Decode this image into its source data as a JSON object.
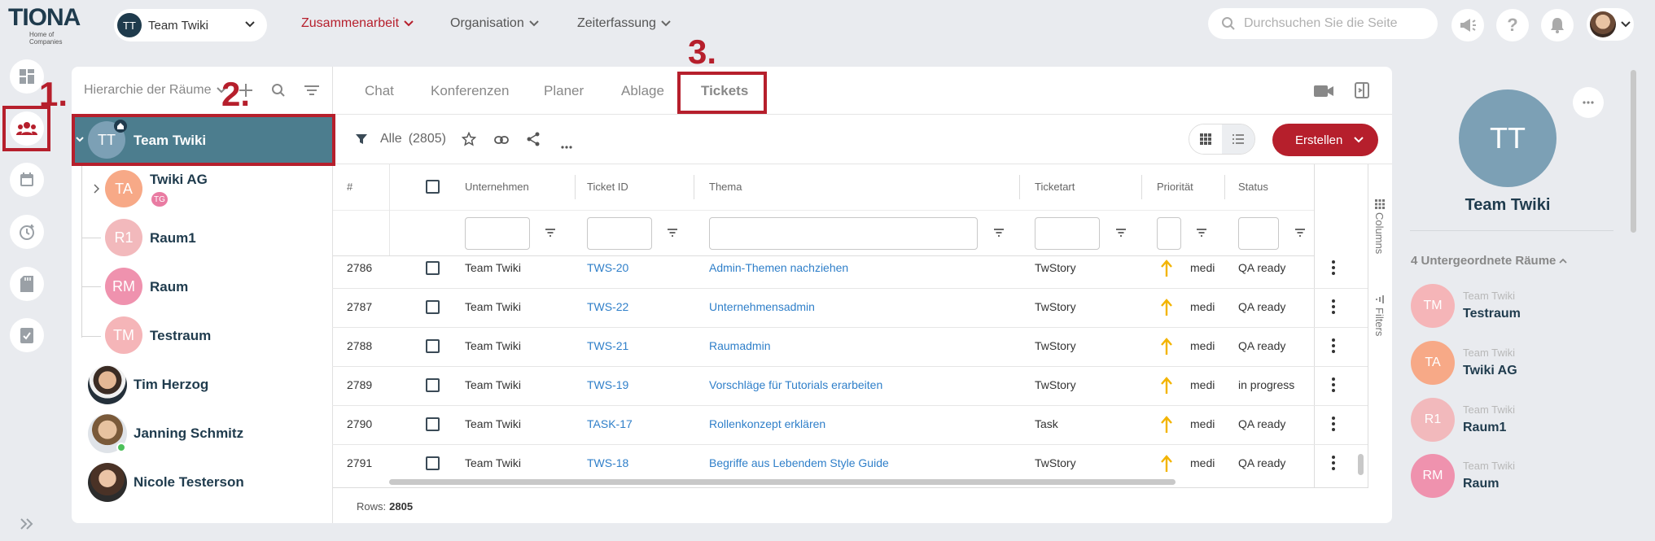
{
  "header": {
    "logo_text": "TIONA",
    "logo_sub": "Home of Companies",
    "team_selector": {
      "initials": "TT",
      "label": "Team Twiki"
    },
    "nav": [
      {
        "label": "Zusammenarbeit",
        "active": true
      },
      {
        "label": "Organisation",
        "active": false
      },
      {
        "label": "Zeiterfassung",
        "active": false
      }
    ],
    "search_placeholder": "Durchsuchen Sie die Seite",
    "icons": [
      "megaphone-icon",
      "help-icon",
      "bell-icon",
      "user-avatar"
    ]
  },
  "annotations": [
    "1.",
    "2.",
    "3."
  ],
  "left_nav": {
    "icons": [
      "dashboard-icon",
      "team-icon",
      "calendar-icon",
      "time-icon",
      "document-icon",
      "checklist-icon"
    ],
    "expand_icon": "double-chevron-right-icon"
  },
  "hierarchy": {
    "title": "Hierarchie der Räume",
    "items": [
      {
        "initials": "TT",
        "label": "Team Twiki",
        "color": "#7ca0b5",
        "selected": true
      },
      {
        "initials": "TA",
        "label": "Twiki AG",
        "badge": "TG",
        "color": "#f7a987"
      },
      {
        "initials": "R1",
        "label": "Raum1",
        "color": "#f2b9bc"
      },
      {
        "initials": "RM",
        "label": "Raum",
        "color": "#ef92ae"
      },
      {
        "initials": "TM",
        "label": "Testraum",
        "color": "#f5b5b8"
      }
    ],
    "users": [
      {
        "label": "Tim Herzog"
      },
      {
        "label": "Janning Schmitz"
      },
      {
        "label": "Nicole Testerson"
      }
    ]
  },
  "tabs": [
    {
      "label": "Chat"
    },
    {
      "label": "Konferenzen"
    },
    {
      "label": "Planer"
    },
    {
      "label": "Ablage"
    },
    {
      "label": "Tickets",
      "active": true
    }
  ],
  "toolbar": {
    "filter_label": "Alle",
    "count": "(2805)",
    "create_label": "Erstellen"
  },
  "table": {
    "columns": [
      "#",
      "Unternehmen",
      "Ticket ID",
      "Thema",
      "Ticketart",
      "Priorität",
      "Status"
    ],
    "rows": [
      {
        "num": "2786",
        "company": "Team Twiki",
        "id": "TWS-20",
        "topic": "Admin-Themen nachziehen",
        "type": "TwStory",
        "priority": "medi",
        "status": "QA ready"
      },
      {
        "num": "2787",
        "company": "Team Twiki",
        "id": "TWS-22",
        "topic": "Unternehmensadmin",
        "type": "TwStory",
        "priority": "medi",
        "status": "QA ready"
      },
      {
        "num": "2788",
        "company": "Team Twiki",
        "id": "TWS-21",
        "topic": "Raumadmin",
        "type": "TwStory",
        "priority": "medi",
        "status": "QA ready"
      },
      {
        "num": "2789",
        "company": "Team Twiki",
        "id": "TWS-19",
        "topic": "Vorschläge für Tutorials erarbeiten",
        "type": "TwStory",
        "priority": "medi",
        "status": "in progress"
      },
      {
        "num": "2790",
        "company": "Team Twiki",
        "id": "TASK-17",
        "topic": "Rollenkonzept erklären",
        "type": "Task",
        "priority": "medi",
        "status": "QA ready"
      },
      {
        "num": "2791",
        "company": "Team Twiki",
        "id": "TWS-18",
        "topic": "Begriffe aus Lebendem Style Guide",
        "type": "TwStory",
        "priority": "medi",
        "status": "QA ready"
      }
    ],
    "side_labels": [
      "Columns",
      "Filters"
    ],
    "rows_label": "Rows:",
    "rows_count": "2805"
  },
  "right_panel": {
    "initials": "TT",
    "title": "Team Twiki",
    "sub_title": "4 Untergeordnete Räume",
    "items": [
      {
        "initials": "TM",
        "parent": "Team Twiki",
        "label": "Testraum",
        "color": "#f5b5b8"
      },
      {
        "initials": "TA",
        "parent": "Team Twiki",
        "label": "Twiki AG",
        "color": "#f7a987"
      },
      {
        "initials": "R1",
        "parent": "Team Twiki",
        "label": "Raum1",
        "color": "#f2b9bc"
      },
      {
        "initials": "RM",
        "parent": "Team Twiki",
        "label": "Raum",
        "color": "#ef92ae"
      }
    ]
  },
  "colors": {
    "brand_red": "#b61f2c",
    "selected_row": "#4c7d8e",
    "link": "#2f7fc9",
    "priority_arrow": "#f3b400"
  }
}
